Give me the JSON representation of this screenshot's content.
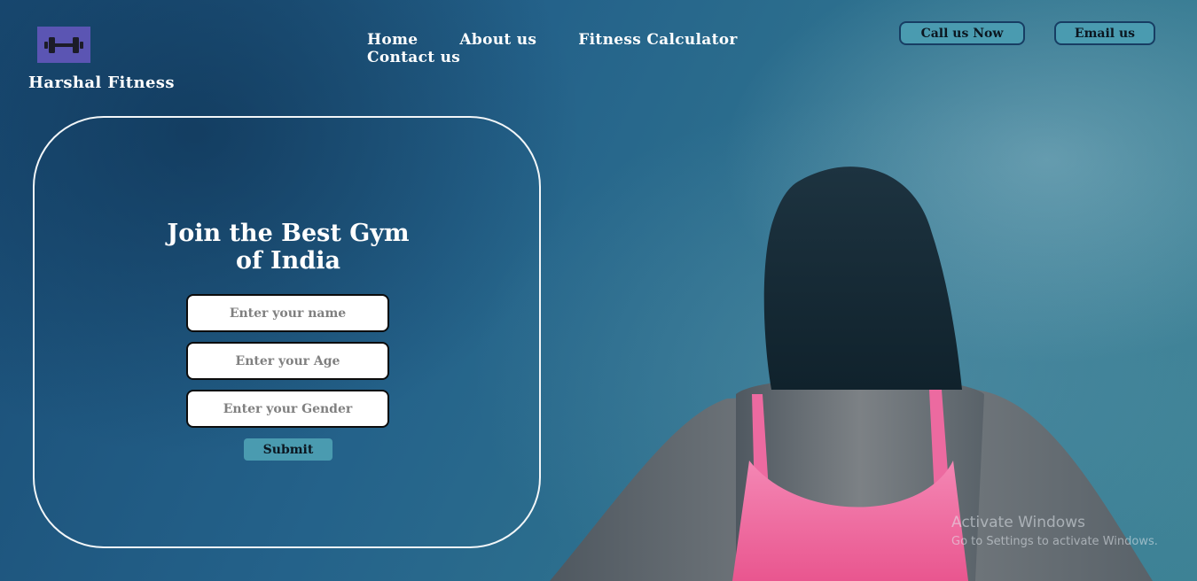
{
  "brand": {
    "name": "Harshal Fitness",
    "logo_icon": "dumbbell-icon",
    "logo_bg": "#5b55b3"
  },
  "nav": {
    "items": [
      {
        "label": "Home"
      },
      {
        "label": "About us"
      },
      {
        "label": "Fitness Calculator"
      },
      {
        "label": "Contact us"
      }
    ]
  },
  "header_buttons": {
    "call_label": "Call us Now",
    "email_label": "Email us"
  },
  "form": {
    "title": "Join the Best Gym of India",
    "name_placeholder": "Enter your name",
    "age_placeholder": "Enter your Age",
    "gender_placeholder": "Enter your Gender",
    "submit_label": "Submit"
  },
  "watermark": {
    "title": "Activate Windows",
    "subtitle": "Go to Settings to activate Windows."
  },
  "colors": {
    "accent": "#4a9bb0",
    "accent_border": "#173d63",
    "top_pink": "#f06fa5"
  }
}
